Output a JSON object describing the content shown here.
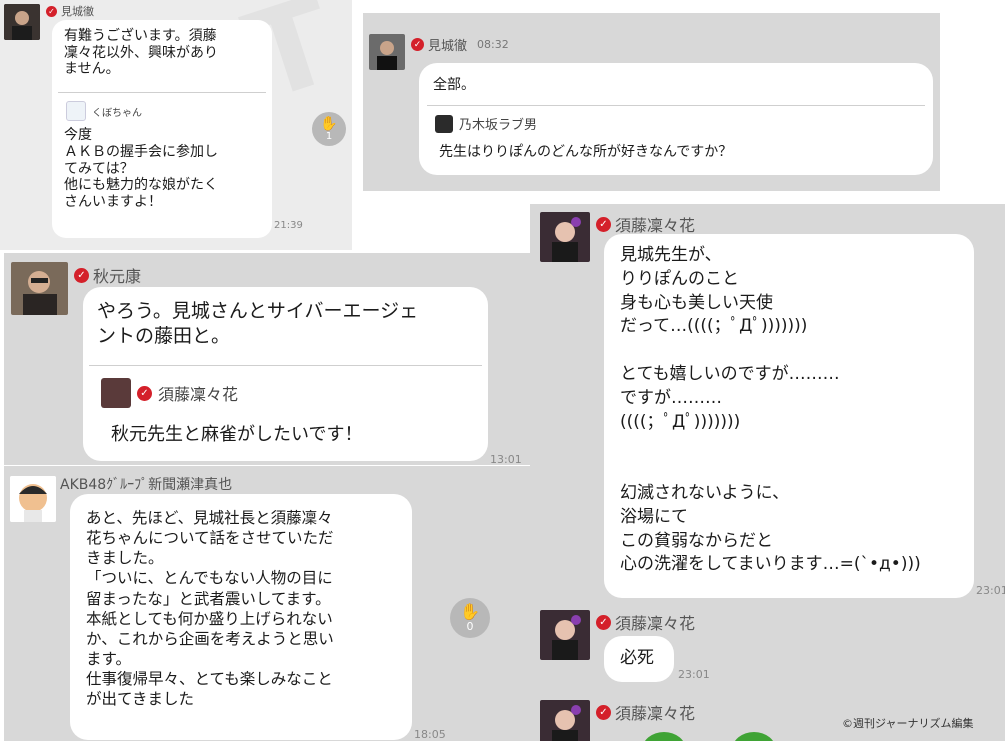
{
  "panel1": {
    "sender": "見城徹",
    "message": "有難うございます。須藤\n凜々花以外、興味があり\nません。",
    "quote_name": "くぼちゃん",
    "quote_text": "今度\nＡＫＢの握手会に参加し\nてみては？\n他にも魅力的な娘がたく\nさんいますよ！",
    "time": "21:39",
    "reaction_count": "1"
  },
  "panel2": {
    "sender": "見城徹",
    "time": "08:32",
    "message": "全部。",
    "quote_name": "乃木坂ラブ男",
    "quote_text": "先生はりりぽんのどんな所が好きなんですか？"
  },
  "panel3": {
    "sender": "秋元康",
    "message": "やろう。見城さんとサイバーエージェ\nントの藤田と。",
    "quote_name": "須藤凜々花",
    "quote_text": "秋元先生と麻雀がしたいです！",
    "time": "13:01"
  },
  "panel4": {
    "sender": "AKB48ｸﾞﾙｰﾌﾟ新聞瀬津真也",
    "message": "あと、先ほど、見城社長と須藤凜々\n花ちゃんについて話をさせていただ\nきました。\n「ついに、とんでもない人物の目に\n留まったな」と武者震いしてます。\n本紙としても何か盛り上げられない\nか、これから企画を考えようと思い\nます。\n仕事復帰早々、とても楽しみなこと\nが出てきました",
    "time": "18:05",
    "reaction_count": "0"
  },
  "panel5": {
    "sender1": "須藤凜々花",
    "message1": "見城先生が、\nりりぽんのこと\n身も心も美しい天使\nだって…((((；ﾟДﾟ)))))))\n\nとても嬉しいのですが………\nですが………\n((((；ﾟДﾟ)))))))\n\n\n幻滅されないように、\n浴場にて\nこの貧弱なからだと\n心の洗濯をしてまいります…=(`•д•)))",
    "time1": "23:01",
    "sender2": "須藤凜々花",
    "message2": "必死",
    "time2": "23:01",
    "sender3": "須藤凜々花"
  },
  "credit": "©週刊ジャーナリズム編集",
  "colors": {
    "badge": "#d4202a",
    "panel_bg": "#d8d8d8",
    "bubble": "#ffffff"
  },
  "icons": [
    "verified-check-icon",
    "applause-hand-icon"
  ]
}
